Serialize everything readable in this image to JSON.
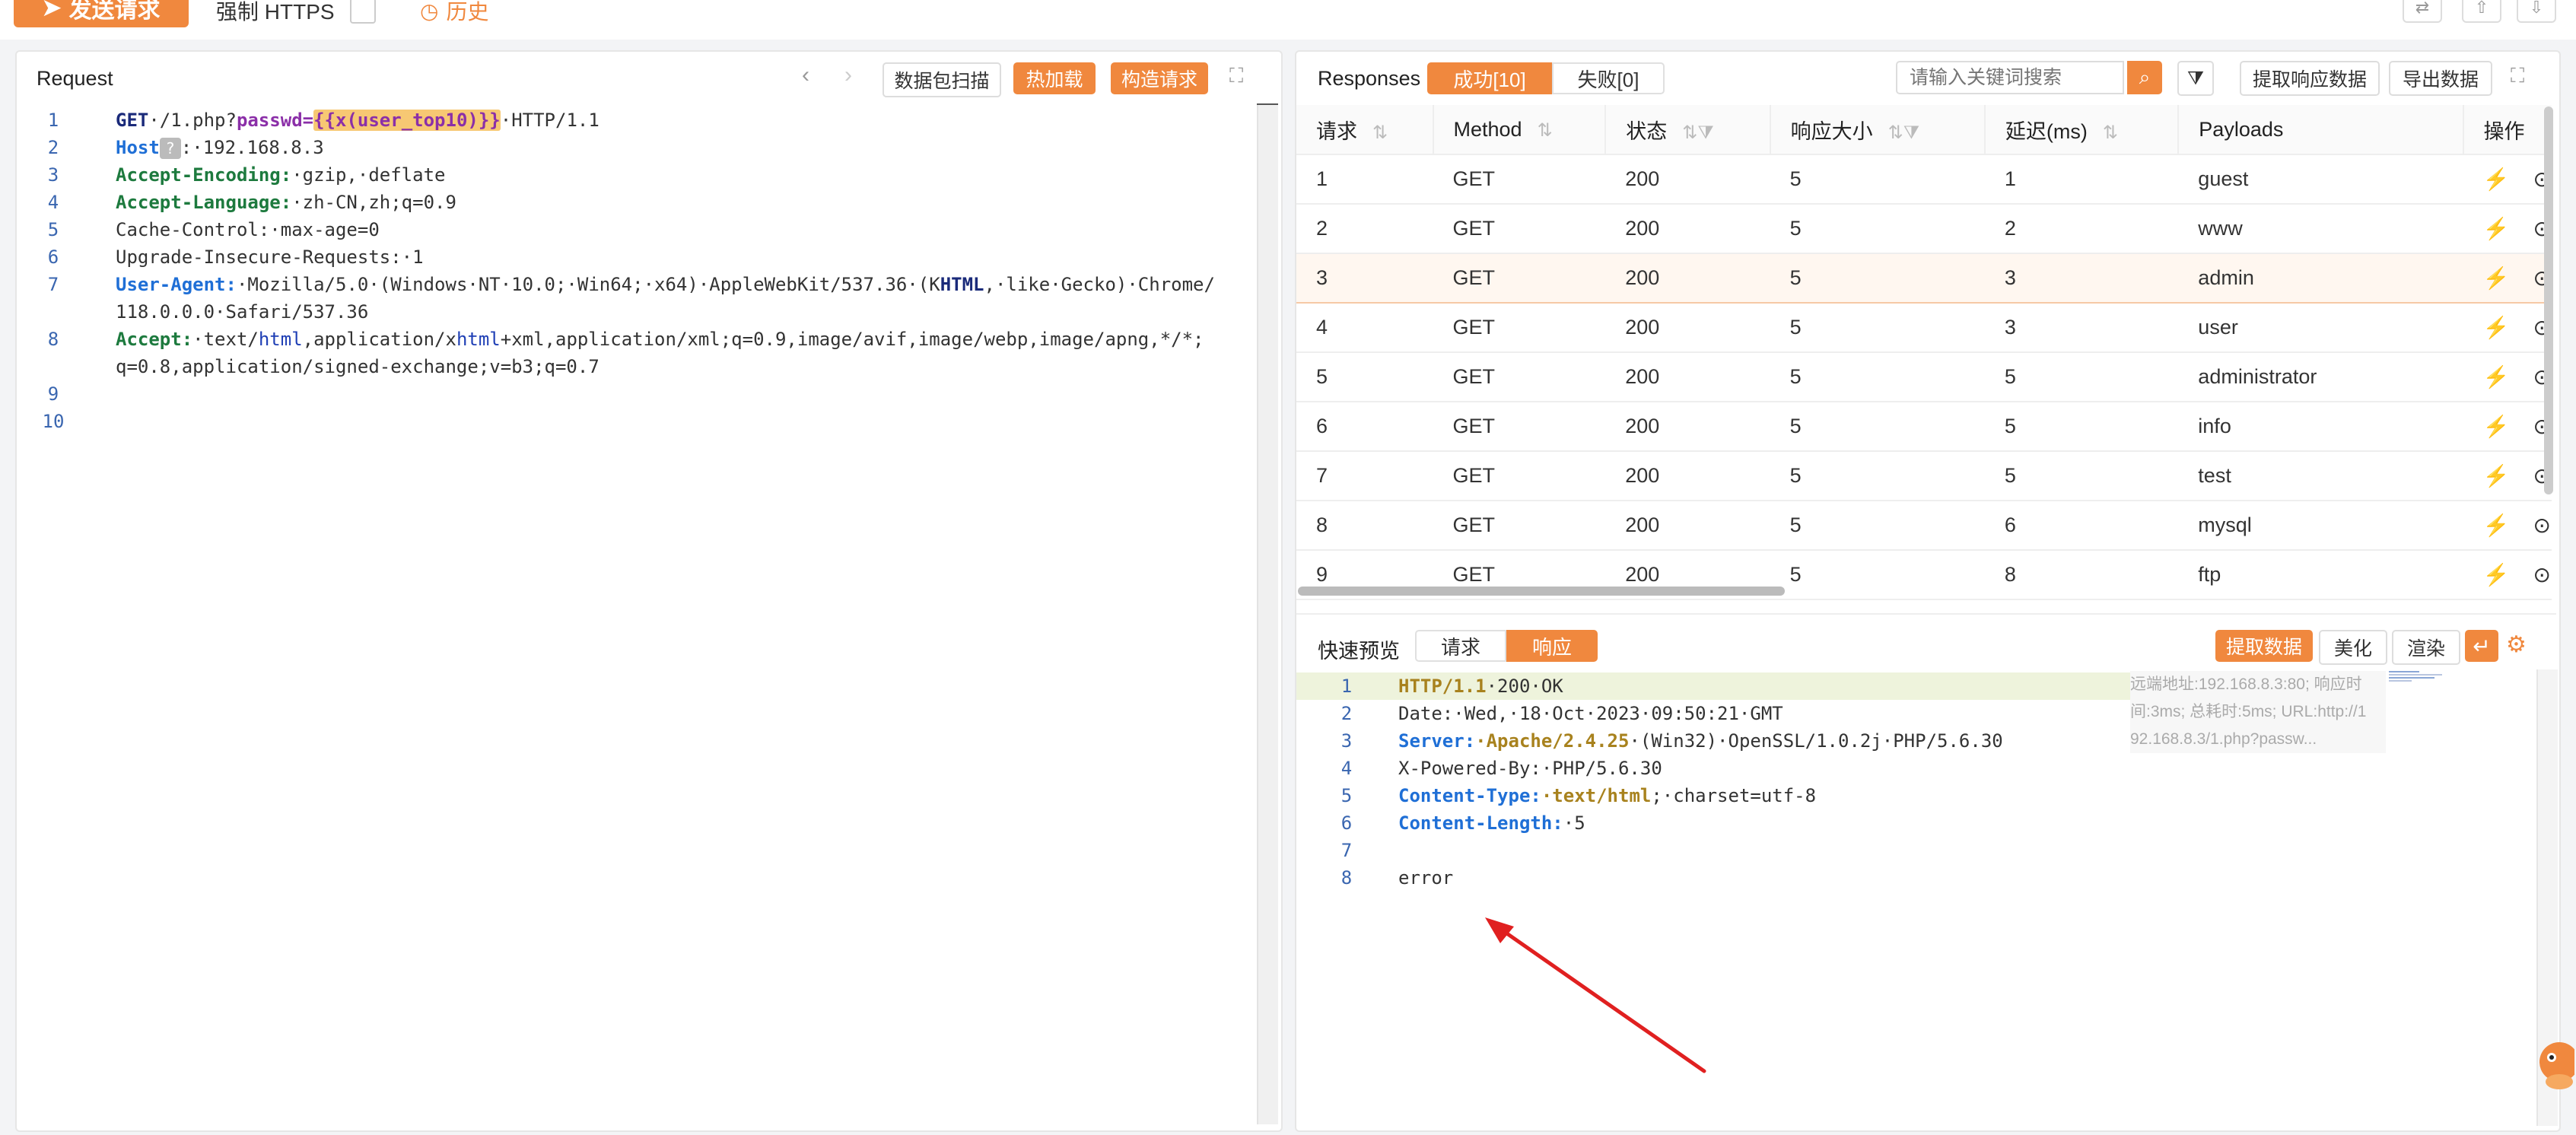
{
  "topbar": {
    "send_label": "发送请求",
    "https_label": "强制 HTTPS",
    "history_label": "历史"
  },
  "request": {
    "title": "Request",
    "btn_scan": "数据包扫描",
    "btn_hotload": "热加载",
    "btn_build": "构造请求",
    "line_numbers": [
      "1",
      "2",
      "3",
      "4",
      "5",
      "6",
      "7",
      "8",
      "9",
      "10"
    ],
    "l1_method": "GET",
    "l1_path": "·/1.php?",
    "l1_param": "passwd=",
    "l1_payload": "{{x(user_top10)}}",
    "l1_proto": "·HTTP/1.1",
    "l2_key": "Host",
    "l2_help": "?",
    "l2_rest": ":·192.168.8.3",
    "l3_key": "Accept-Encoding:",
    "l3_val": "·gzip,·deflate",
    "l4_key": "Accept-Language:",
    "l4_val": "·zh-CN,zh;q=0.9",
    "l5": "Cache-Control:·max-age=0",
    "l6": "Upgrade-Insecure-Requests:·1",
    "l7_key": "User-Agent:",
    "l7_a": "·Mozilla/5.0·(Windows·NT·10.0;·Win64;·x64)·AppleWebKit/537.36·(K",
    "l7_b": "HTML",
    "l7_c": ",·like·Gecko)·Chrome/",
    "l7_wrap": "118.0.0.0·Safari/537.36",
    "l8_key": "Accept:",
    "l8_a": "·text/",
    "l8_b": "html",
    "l8_c": ",application/x",
    "l8_d": "html",
    "l8_e": "+xml,application/xml;q=0.9,image/avif,image/webp,image/apng,*/*;",
    "l8_wrap": "q=0.8,application/signed-exchange;v=b3;q=0.7"
  },
  "responses": {
    "title": "Responses",
    "tab_success": "成功[10]",
    "tab_fail": "失败[0]",
    "search_placeholder": "请输入关键词搜索",
    "btn_extract": "提取响应数据",
    "btn_export": "导出数据",
    "columns": [
      "请求",
      "Method",
      "状态",
      "响应大小",
      "延迟(ms)",
      "Payloads",
      "操作"
    ],
    "rows": [
      {
        "id": "1",
        "method": "GET",
        "status": "200",
        "size": "5",
        "delay": "1",
        "payload": "guest"
      },
      {
        "id": "2",
        "method": "GET",
        "status": "200",
        "size": "5",
        "delay": "2",
        "payload": "www"
      },
      {
        "id": "3",
        "method": "GET",
        "status": "200",
        "size": "5",
        "delay": "3",
        "payload": "admin"
      },
      {
        "id": "4",
        "method": "GET",
        "status": "200",
        "size": "5",
        "delay": "3",
        "payload": "user"
      },
      {
        "id": "5",
        "method": "GET",
        "status": "200",
        "size": "5",
        "delay": "5",
        "payload": "administrator"
      },
      {
        "id": "6",
        "method": "GET",
        "status": "200",
        "size": "5",
        "delay": "5",
        "payload": "info"
      },
      {
        "id": "7",
        "method": "GET",
        "status": "200",
        "size": "5",
        "delay": "5",
        "payload": "test"
      },
      {
        "id": "8",
        "method": "GET",
        "status": "200",
        "size": "5",
        "delay": "6",
        "payload": "mysql"
      },
      {
        "id": "9",
        "method": "GET",
        "status": "200",
        "size": "5",
        "delay": "8",
        "payload": "ftp"
      }
    ]
  },
  "preview": {
    "title": "快速预览",
    "tab_request": "请求",
    "tab_response": "响应",
    "btn_extract": "提取数据",
    "btn_beautify": "美化",
    "btn_render": "渲染",
    "line_numbers": [
      "1",
      "2",
      "3",
      "4",
      "5",
      "6",
      "7",
      "8"
    ],
    "r1_a": "HTTP/1.1",
    "r1_b": "·200·OK",
    "r2": "Date:·Wed,·18·Oct·2023·09:50:21·GMT",
    "r3_key": "Server:",
    "r3_val": "·Apache/2.4.25",
    "r3_rest": "·(Win32)·OpenSSL/1.0.2j·PHP/5.6.30",
    "r4": "X-Powered-By:·PHP/5.6.30",
    "r5_key": "Content-Type:",
    "r5_val": "·text/html",
    "r5_rest": ";·charset=utf-8",
    "r6_key": "Content-Length:",
    "r6_val": "·5",
    "r8": "error",
    "meta_1": "远端地址:192.168.8.3:80;  响应时",
    "meta_2": "间:3ms;  总耗时:5ms;  URL:http://1",
    "meta_3": "92.168.8.3/1.php?passw..."
  },
  "colors": {
    "accent": "#f0883e",
    "status_ok": "#27a66a",
    "annotation_arrow": "#e02020"
  }
}
